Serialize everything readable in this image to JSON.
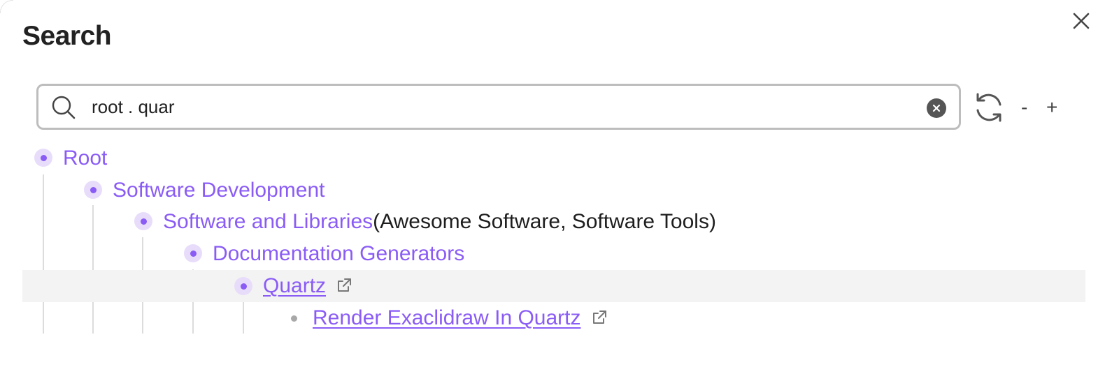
{
  "modal": {
    "title": "Search"
  },
  "search": {
    "value": "root . quar",
    "placeholder": ""
  },
  "controls": {
    "zoom_out_label": "-",
    "zoom_in_label": "+"
  },
  "tree": {
    "nodes": [
      {
        "label": "Root",
        "aliases": ""
      },
      {
        "label": "Software Development",
        "aliases": ""
      },
      {
        "label": "Software and Libraries",
        "aliases": "(Awesome Software, Software Tools)"
      },
      {
        "label": "Documentation Generators",
        "aliases": ""
      },
      {
        "label": "Quartz",
        "aliases": ""
      },
      {
        "label": "Render Exaclidraw In Quartz",
        "aliases": ""
      }
    ]
  },
  "colors": {
    "accent": "#8a5cf5",
    "bullet_bg": "#e8dcfb",
    "highlight_row": "#f3f3f3",
    "search_border": "#bdbdbd"
  },
  "icons": [
    "close-icon",
    "search-icon",
    "clear-icon",
    "refresh-icon",
    "external-link-icon"
  ]
}
